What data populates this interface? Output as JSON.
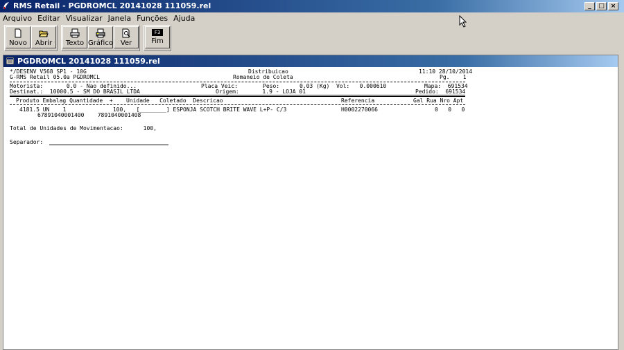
{
  "window": {
    "title": "RMS Retail - PGDROMCL 20141028 111059.rel",
    "controls": [
      "_",
      "□",
      "×"
    ]
  },
  "menu": [
    "Arquivo",
    "Editar",
    "Visualizar",
    "Janela",
    "Funções",
    "Ajuda"
  ],
  "toolbar": {
    "groups": [
      [
        {
          "label": "Novo",
          "icon": "new-file-icon"
        },
        {
          "label": "Abrir",
          "icon": "open-folder-icon"
        }
      ],
      [
        {
          "label": "Texto",
          "icon": "printer-icon"
        },
        {
          "label": "Gráfico",
          "icon": "printer-color-icon"
        },
        {
          "label": "Ver",
          "icon": "preview-icon"
        }
      ],
      [
        {
          "label": "Fim",
          "key": "F3"
        }
      ]
    ]
  },
  "child": {
    "title": "PGDROMCL 20141028 111059.rel"
  },
  "report": {
    "line1_left": "*/DESENV V568 SP1 - 10G",
    "line1_center": "Distribuicao",
    "line1_right": "11:10 28/10/2014",
    "line2_left": "G-RMS Retail 05.0a PGDROMCL",
    "line2_center": "Romaneio de Coleta",
    "line2_right": "Pg.    1",
    "motorista": "Motorista:       0.0 - Nao definido...",
    "placa": "Placa Veic:",
    "peso": "Peso:      0,03 (Kg)  Vol:   0.000610",
    "mapa": "Mapa:  691534",
    "destinat": "Destinat.:  10000.5 - SM DO BRASIL LTDA",
    "origem": "Origem:       1.9 - LOJA 01",
    "pedido": "Pedido:  691534",
    "col_header": "Produto Embalag Quantidade  +    Unidade   Coletado  Descricao",
    "col_ref": "Referencia",
    "col_loc": "Gal Rua Nro Apt",
    "item_line1": "4181.5 UN    1              100,   [________] ESPONJA SCOTCH BRITE WAVE L+P- C/3",
    "item_ref": "H0002270066",
    "item_loc": "0   0   0",
    "item_line2": "67891040001400    7891040001408",
    "total": "Total de Unidades de Movimentacao:      100,",
    "separador": "Separador:"
  }
}
